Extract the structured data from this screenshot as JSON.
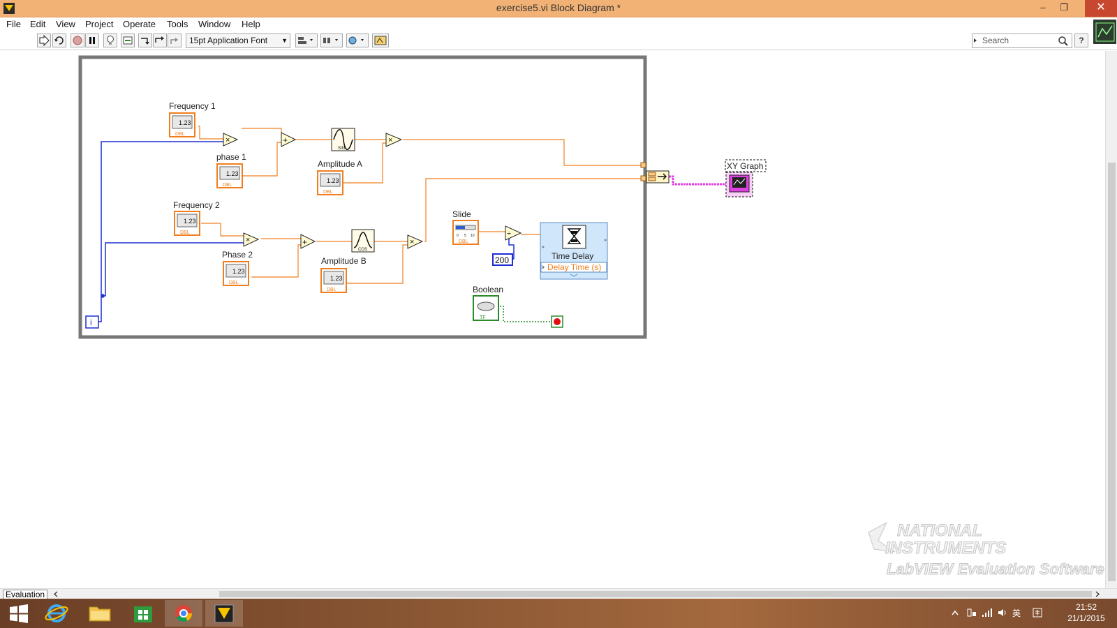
{
  "window": {
    "title": "exercise5.vi Block Diagram *",
    "minimize_glyph": "–",
    "restore_glyph": "❐",
    "close_glyph": "✕"
  },
  "menu": [
    "File",
    "Edit",
    "View",
    "Project",
    "Operate",
    "Tools",
    "Window",
    "Help"
  ],
  "toolbar": {
    "font_selector": "15pt Application Font",
    "search_placeholder": "Search",
    "help_glyph": "?"
  },
  "diagram": {
    "labels": {
      "frequency1": "Frequency 1",
      "phase1": "phase 1",
      "amplitudeA": "Amplitude A",
      "frequency2": "Frequency 2",
      "phase2": "Phase 2",
      "amplitudeB": "Amplitude B",
      "slide": "Slide",
      "boolean": "Boolean",
      "xygraph": "XY Graph",
      "time_delay": "Time Delay",
      "delay_time": "Delay Time (s)"
    },
    "constants": {
      "divisor": "200"
    },
    "terminal_text": {
      "numeric": "1.23",
      "dbl": "DBL",
      "tf": "TF",
      "iteration": "i"
    },
    "operators": {
      "multiply": "×",
      "add": "+",
      "divide": "÷"
    },
    "functions": {
      "sine": "SIN",
      "cosine": "COS"
    },
    "slide_scale": [
      "0",
      "5",
      "10"
    ]
  },
  "watermark": {
    "line1": "NATIONAL",
    "line2": "INSTRUMENTS",
    "line3": "LabVIEW Evaluation Software"
  },
  "status": {
    "evaluation_tab": "Evaluation"
  },
  "taskbar": {
    "time": "21:52",
    "date": "21/1/2015",
    "ime": "英"
  },
  "colors": {
    "title_bar": "#f2b276",
    "double_wire": "#f07e1e",
    "integer_wire": "#1e2fd0",
    "boolean_wire": "#2a8a2a",
    "cluster_wire": "#e040e0"
  }
}
